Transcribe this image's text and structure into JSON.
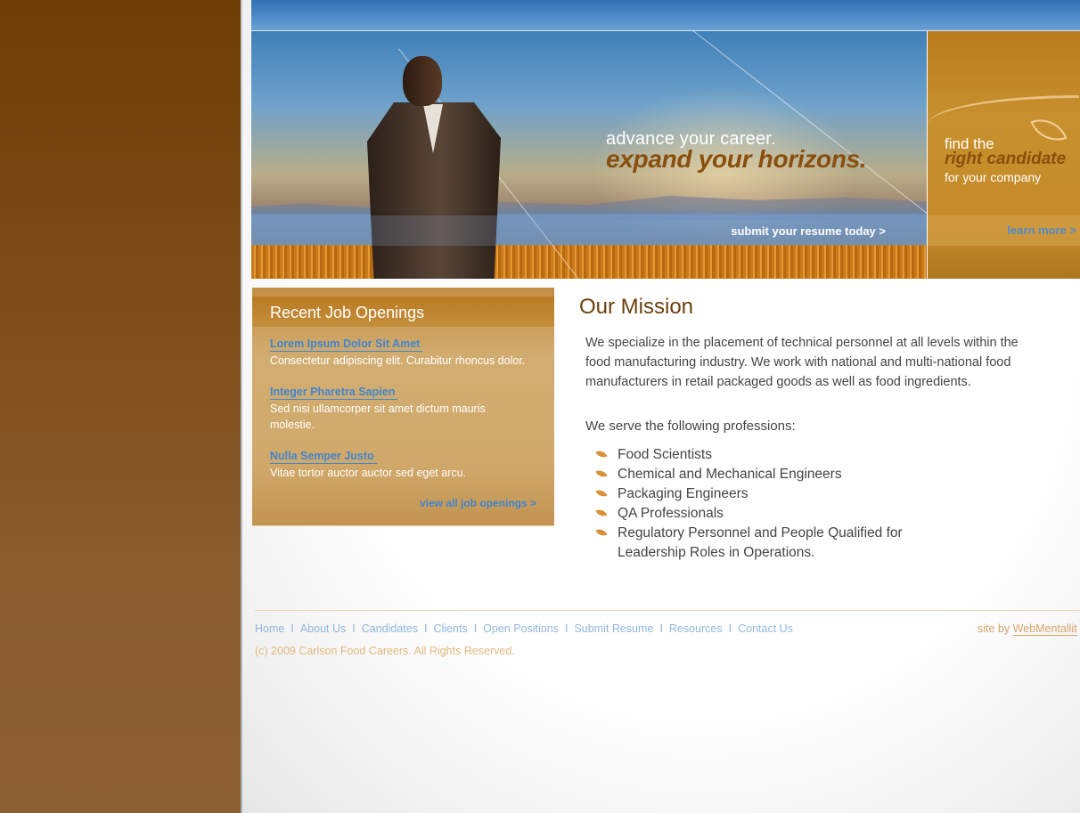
{
  "hero": {
    "tagline_line1": "advance your career.",
    "tagline_line2": "expand your horizons.",
    "cta": "submit your resume today >"
  },
  "promo": {
    "line1": "find the",
    "line2": "right candidate",
    "line3": "for your company",
    "cta": "learn more >"
  },
  "jobs": {
    "title": "Recent Job Openings",
    "items": [
      {
        "title": "Lorem Ipsum Dolor Sit Amet",
        "desc": "Consectetur adipiscing elit. Curabitur rhoncus dolor."
      },
      {
        "title": "Integer Pharetra Sapien",
        "desc": "Sed nisi ullamcorper sit amet dictum mauris molestie."
      },
      {
        "title": "Nulla Semper Justo",
        "desc": "Vitae tortor auctor auctor sed eget arcu."
      }
    ],
    "view_all": "view all job openings >"
  },
  "mission": {
    "title": "Our Mission",
    "text": "We specialize in the placement of technical personnel at all levels within the food manufacturing industry.  We work with national and multi-national food manufacturers in retail packaged goods as well as food ingredients.",
    "serve": "We serve the following professions:",
    "professions": [
      "Food Scientists",
      "Chemical and Mechanical Engineers",
      "Packaging Engineers",
      "QA Professionals",
      "Regulatory Personnel and People Qualified for Leadership Roles in Operations."
    ]
  },
  "footer": {
    "nav": [
      "Home",
      "About Us",
      "Candidates",
      "Clients",
      "Open Positions",
      "Submit Resume",
      "Resources",
      "Contact Us"
    ],
    "separator": "I",
    "copyright": "(c) 2009 Carlson Food Careers. All Rights Reserved.",
    "site_by_label": "site by",
    "site_by_link": "WebMentallit"
  },
  "colors": {
    "brand_brown": "#6b3f0e",
    "accent_orange": "#c8902e",
    "link_blue": "#3f86d1",
    "top_bar_blue": "#4f8cc9"
  }
}
